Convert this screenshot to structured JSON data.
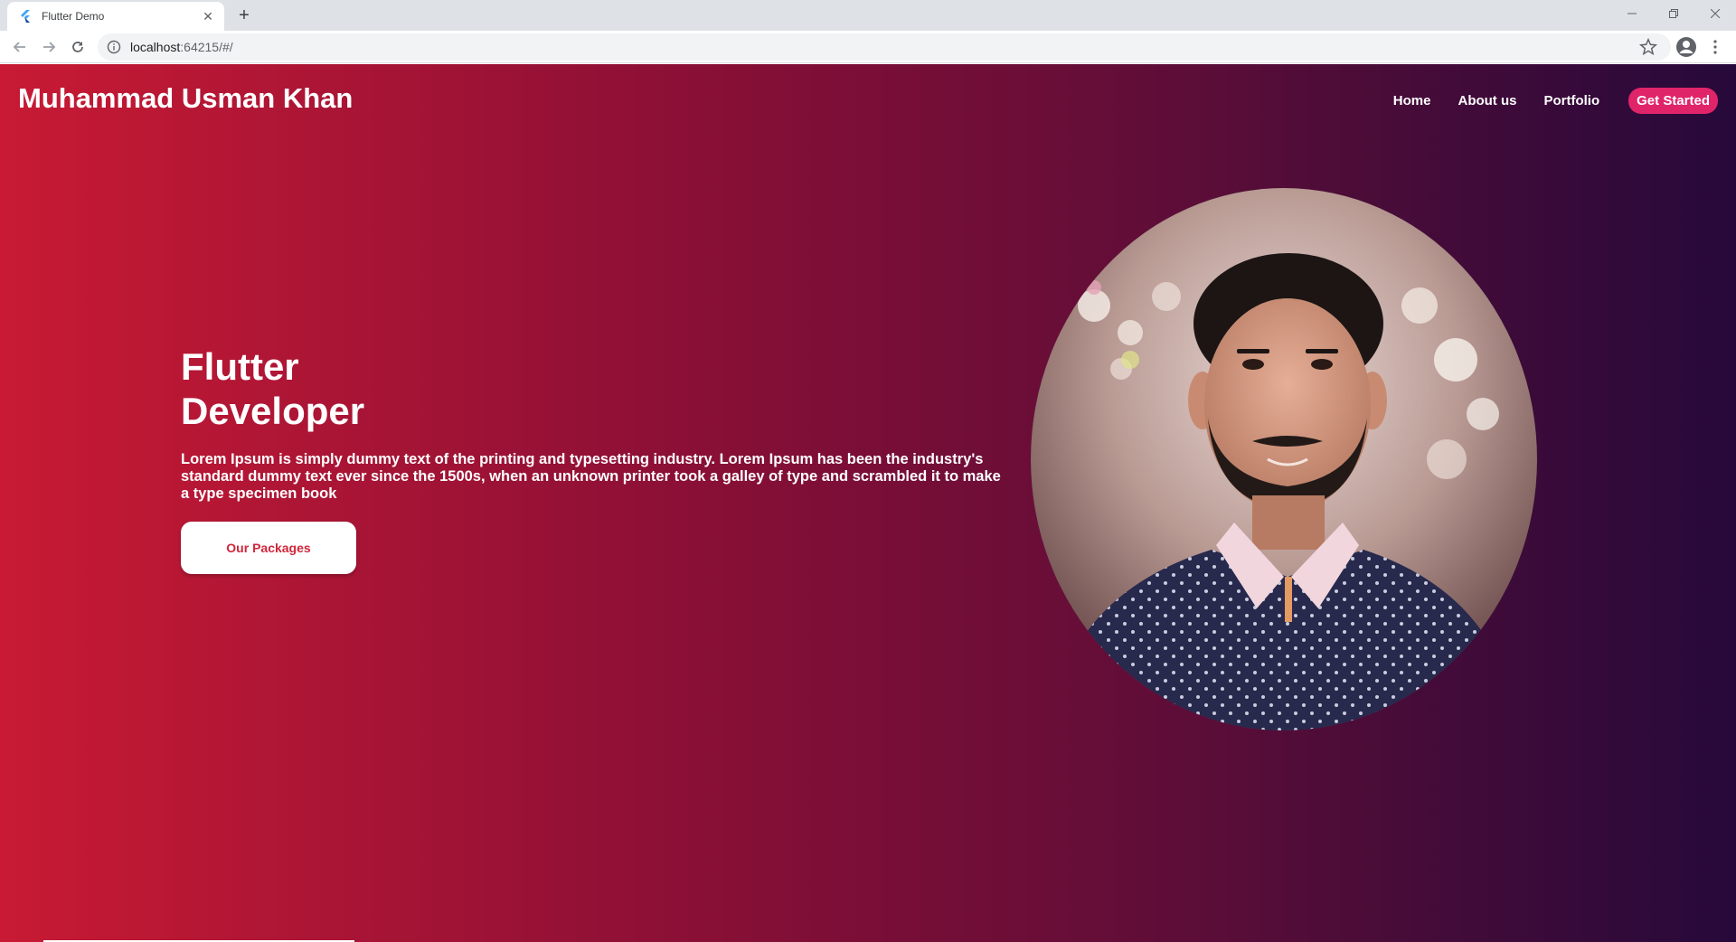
{
  "browser": {
    "tab_title": "Flutter Demo",
    "url_host": "localhost",
    "url_rest": ":64215/#/"
  },
  "site": {
    "brand": "Muhammad Usman Khan",
    "nav": {
      "home": "Home",
      "about": "About us",
      "portfolio": "Portfolio",
      "cta": "Get Started"
    },
    "hero": {
      "title_line1": "Flutter",
      "title_line2": "Developer",
      "description": "Lorem Ipsum is simply dummy text of the printing and typesetting industry. Lorem Ipsum has been the industry's standard dummy text ever since the 1500s, when an unknown printer took a galley of type and scrambled it to make a type specimen book",
      "button": "Our Packages"
    }
  },
  "colors": {
    "gradient_start": "#c81a34",
    "gradient_end": "#26093a",
    "cta": "#e0246a",
    "button_text": "#d0263a"
  },
  "icons": {
    "tab_favicon": "flutter-logo-icon",
    "back": "arrow-left-icon",
    "forward": "arrow-right-icon",
    "reload": "reload-icon",
    "info": "info-icon",
    "bookmark": "star-icon",
    "profile": "account-circle-icon",
    "menu": "kebab-menu-icon"
  }
}
